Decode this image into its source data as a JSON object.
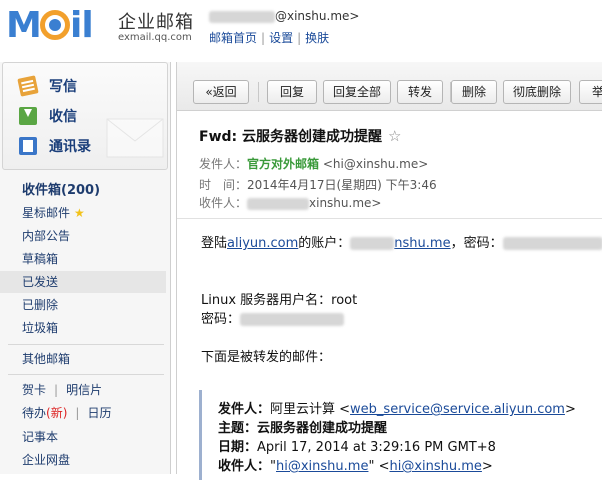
{
  "header": {
    "logo_m": "M",
    "logo_il": "il",
    "brand_cn": "企业邮箱",
    "brand_url": "exmail.qq.com",
    "user_email_suffix": "@xinshu.me>",
    "links": [
      "邮箱首页",
      "设置",
      "换肤"
    ]
  },
  "sidebar": {
    "quick": [
      {
        "label": "写信",
        "icon": "compose-icon"
      },
      {
        "label": "收信",
        "icon": "inbox-download-icon"
      },
      {
        "label": "通讯录",
        "icon": "address-book-icon"
      }
    ],
    "inbox": "收件箱(200)",
    "starred": "星标邮件",
    "folders": [
      "内部公告",
      "草稿箱",
      "已发送",
      "已删除",
      "垃圾箱"
    ],
    "other_mailbox": "其他邮箱",
    "cards": "贺卡",
    "postcards": "明信片",
    "todo": "待办",
    "todo_new": "(新)",
    "calendar": "日历",
    "notes": "记事本",
    "netdisk": "企业网盘"
  },
  "toolbar": {
    "buttons": [
      "«返回",
      "回复",
      "回复全部",
      "转发",
      "删除",
      "彻底删除",
      "举"
    ]
  },
  "message": {
    "subject": "Fwd: 云服务器创建成功提醒",
    "star": "☆",
    "from_label": "发件人：",
    "from_name": "官方对外邮箱",
    "from_addr": "<hi@xinshu.me>",
    "time_label": "时　间：",
    "time_value": "2014年4月17日(星期四) 下午3:46",
    "to_label": "收件人：",
    "to_suffix": "xinshu.me>",
    "body": {
      "line1_a": "登陆",
      "line1_link": "aliyun.com",
      "line1_b": "的账户：",
      "line1_email_suffix": "nshu.me",
      "line1_c": "，密码：",
      "line2": "Linux 服务器用户名：root",
      "line3": "密码：",
      "line4": "下面是被转发的邮件："
    },
    "quote": {
      "from_label": "发件人：",
      "from_name": "阿里云计算 <",
      "from_link": "web_service@service.aliyun.com",
      "from_end": ">",
      "subject_label": "主题：",
      "subject_value": "云服务器创建成功提醒",
      "date_label": "日期：",
      "date_value": "April 17, 2014 at 3:29:16 PM GMT+8",
      "to_label": "收件人：",
      "to_q1": "\"",
      "to_link1": "hi@xinshu.me",
      "to_q2": "\" <",
      "to_link2": "hi@xinshu.me",
      "to_end": ">"
    }
  }
}
